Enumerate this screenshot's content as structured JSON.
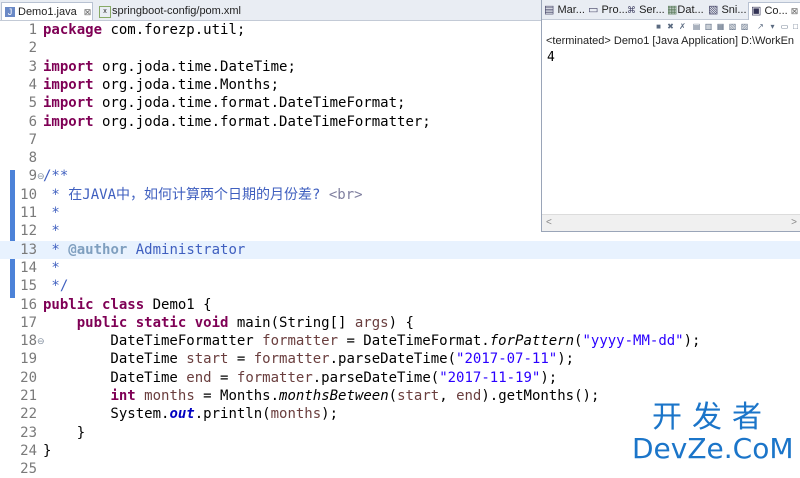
{
  "tabs": [
    {
      "label": "Demo1.java",
      "close": "⊠",
      "icon": "java-file-icon"
    },
    {
      "label": "springboot-config/pom.xml",
      "icon": "xml-file-icon"
    }
  ],
  "editor": {
    "lines": [
      {
        "n": "1"
      },
      {
        "n": "2"
      },
      {
        "n": "3"
      },
      {
        "n": "4"
      },
      {
        "n": "5"
      },
      {
        "n": "6"
      },
      {
        "n": "7"
      },
      {
        "n": "8"
      },
      {
        "n": "9"
      },
      {
        "n": "10"
      },
      {
        "n": "11"
      },
      {
        "n": "12"
      },
      {
        "n": "13"
      },
      {
        "n": "14"
      },
      {
        "n": "15"
      },
      {
        "n": "16"
      },
      {
        "n": "17"
      },
      {
        "n": "18"
      },
      {
        "n": "19"
      },
      {
        "n": "20"
      },
      {
        "n": "21"
      },
      {
        "n": "22"
      },
      {
        "n": "23"
      },
      {
        "n": "24"
      },
      {
        "n": "25"
      }
    ],
    "code": {
      "l1_kw": "package",
      "l1_rest": " com.forezp.util;",
      "l3_kw": "import",
      "l3_rest": " org.joda.time.DateTime;",
      "l4_kw": "import",
      "l4_rest": " org.joda.time.Months;",
      "l5_kw": "import",
      "l5_rest": " org.joda.time.format.DateTimeFormat;",
      "l6_kw": "import",
      "l6_rest": " org.joda.time.format.DateTimeFormatter;",
      "l9": "/**",
      "l10_a": " * 在JAVA中，如何计算两个日期的月份差? ",
      "l10_tag": "<br>",
      "l11": " *",
      "l12": " *",
      "l13_a": " * ",
      "l13_tag": "@author",
      "l13_b": " Administrator",
      "l14": " *",
      "l15": " */",
      "l16_kw": "public class",
      "l16_rest": " Demo1 {",
      "l17_ind": "    ",
      "l17_kw": "public static void",
      "l17_a": " main(String[] ",
      "l17_var": "args",
      "l17_b": ") {",
      "l18_a": "        DateTimeFormatter ",
      "l18_var": "formatter",
      "l18_b": " = DateTimeFormat.",
      "l18_m": "forPattern",
      "l18_c": "(",
      "l18_str": "\"yyyy-MM-dd\"",
      "l18_d": ");",
      "l19_a": "        DateTime ",
      "l19_var": "start",
      "l19_b": " = ",
      "l19_var2": "formatter",
      "l19_c": ".parseDateTime(",
      "l19_str": "\"2017-07-11\"",
      "l19_d": ");",
      "l20_a": "        DateTime ",
      "l20_var": "end",
      "l20_b": " = ",
      "l20_var2": "formatter",
      "l20_c": ".parseDateTime(",
      "l20_str": "\"2017-11-19\"",
      "l20_d": ");",
      "l21_ind": "        ",
      "l21_kw": "int",
      "l21_sp": " ",
      "l21_var": "months",
      "l21_b": " = Months.",
      "l21_m": "monthsBetween",
      "l21_c": "(",
      "l21_var2": "start",
      "l21_d": ", ",
      "l21_var3": "end",
      "l21_e": ").getMonths();",
      "l22_a": "        System.",
      "l22_f": "out",
      "l22_b": ".println(",
      "l22_var": "months",
      "l22_c": ");",
      "l23": "    }",
      "l24": "}"
    }
  },
  "console": {
    "tabs": [
      {
        "label": "Mar...",
        "icon": "markers-icon"
      },
      {
        "label": "Pro...",
        "icon": "properties-icon"
      },
      {
        "label": "Ser...",
        "icon": "servers-icon"
      },
      {
        "label": "Dat...",
        "icon": "data-source-icon"
      },
      {
        "label": "Sni...",
        "icon": "snippets-icon"
      },
      {
        "label": "Co...",
        "icon": "console-icon",
        "close": "⊠"
      }
    ],
    "status": "<terminated> Demo1 [Java Application] D:\\WorkEn",
    "output": "4"
  },
  "watermark": {
    "cn": "开发者",
    "en": "DevZe.CoM"
  },
  "colors": {
    "keyword": "#7f0055",
    "comment": "#3f5fbf",
    "string": "#2a00ff",
    "field": "#0000c0",
    "watermark": "#1b75c9"
  }
}
